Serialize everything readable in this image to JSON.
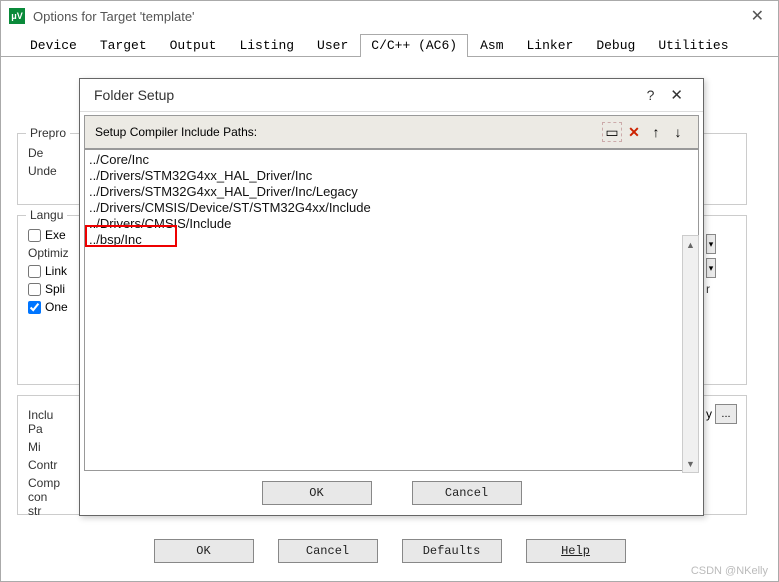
{
  "window": {
    "title": "Options for Target 'template'",
    "app_icon_text": "μV"
  },
  "tabs": [
    "Device",
    "Target",
    "Output",
    "Listing",
    "User",
    "C/C++ (AC6)",
    "Asm",
    "Linker",
    "Debug",
    "Utilities"
  ],
  "active_tab_index": 5,
  "groups": {
    "prepro": "Prepro",
    "def": "De",
    "undef": "Unde",
    "langu": "Langu",
    "exec": "Exe",
    "optimiz": "Optimiz",
    "link": "Link",
    "split": "Spli",
    "one": "One",
    "include_paths": "Inclu\nPa",
    "misc": "Mi",
    "controls": "Contr",
    "compiler_control": "Comp\ncon\nstr",
    "right_char": "r",
    "ellipsis": "...",
    "y": "y"
  },
  "buttons": {
    "ok": "OK",
    "cancel": "Cancel",
    "defaults": "Defaults",
    "help": "Help"
  },
  "modal": {
    "title": "Folder Setup",
    "subtitle": "Setup Compiler Include Paths:",
    "paths": [
      "../Core/Inc",
      "../Drivers/STM32G4xx_HAL_Driver/Inc",
      "../Drivers/STM32G4xx_HAL_Driver/Inc/Legacy",
      "../Drivers/CMSIS/Device/ST/STM32G4xx/Include",
      "../Drivers/CMSIS/Include",
      "../bsp/Inc"
    ],
    "highlight_index": 5,
    "ok": "OK",
    "cancel": "Cancel",
    "toolbar": {
      "new": "▭",
      "delete": "✕",
      "up": "↑",
      "down": "↓"
    }
  },
  "watermark": "CSDN @NKelly"
}
